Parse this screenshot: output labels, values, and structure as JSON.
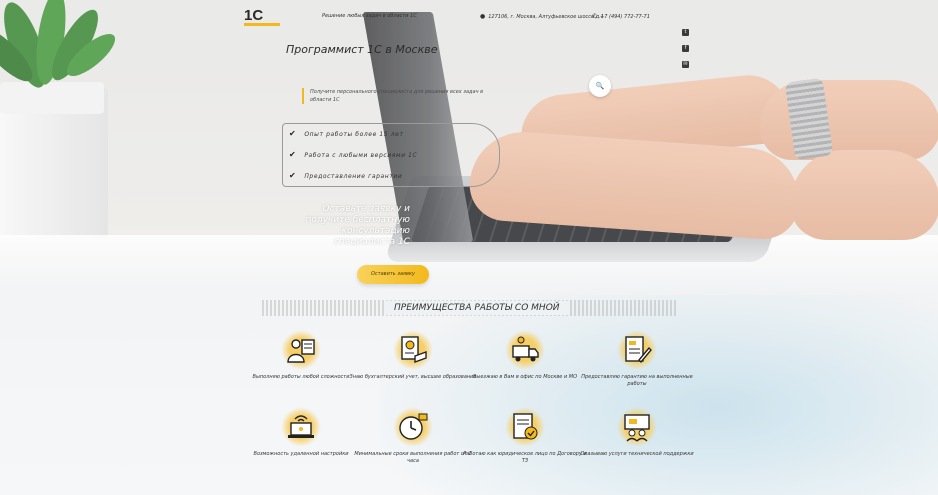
{
  "header": {
    "logo_text": "1С",
    "tagline": "Решение любых задач в области 1С",
    "address": "127106, г. Москва, Алтуфьевское шоссе д.1",
    "phone": "+7 (494) 772-77-71",
    "social": [
      "twitter-icon",
      "facebook-icon",
      "email-icon"
    ]
  },
  "hero": {
    "title": "Программист 1С в Москве",
    "subtitle": "Получите персонального специалиста для решения всех задач в области 1С",
    "features": [
      "Опыт работы более 15 лет",
      "Работа с любыми версиями 1С",
      "Предоставление гарантии"
    ],
    "cta_text": "Оставьте заявку и получите бесплатную консультацию специалиста 1С",
    "cta_button": "Оставить заявку"
  },
  "advantages": {
    "title": "ПРЕИМУЩЕСТВА РАБОТЫ СО МНОЙ",
    "items": [
      {
        "label": "Выполняю работы любой сложности",
        "icon": "specialist-icon"
      },
      {
        "label": "Знаю бухгалтерский учет, высшее образование",
        "icon": "diploma-icon"
      },
      {
        "label": "Выезжаю в Вам в офис по Москве и МО",
        "icon": "delivery-truck-icon"
      },
      {
        "label": "Предоставляю гарантию на выполненные работы",
        "icon": "contract-icon"
      },
      {
        "label": "Возможность удаленной настройки",
        "icon": "remote-laptop-icon"
      },
      {
        "label": "Минимальные сроки выполнения работ от 1 часа",
        "icon": "clock-icon"
      },
      {
        "label": "Работаю как юридическое лицо по Договору и ТЗ",
        "icon": "document-check-icon"
      },
      {
        "label": "Оказываю услуги технической поддержки",
        "icon": "support-chat-icon"
      }
    ]
  },
  "colors": {
    "accent": "#f3b91c",
    "text": "#333333"
  }
}
